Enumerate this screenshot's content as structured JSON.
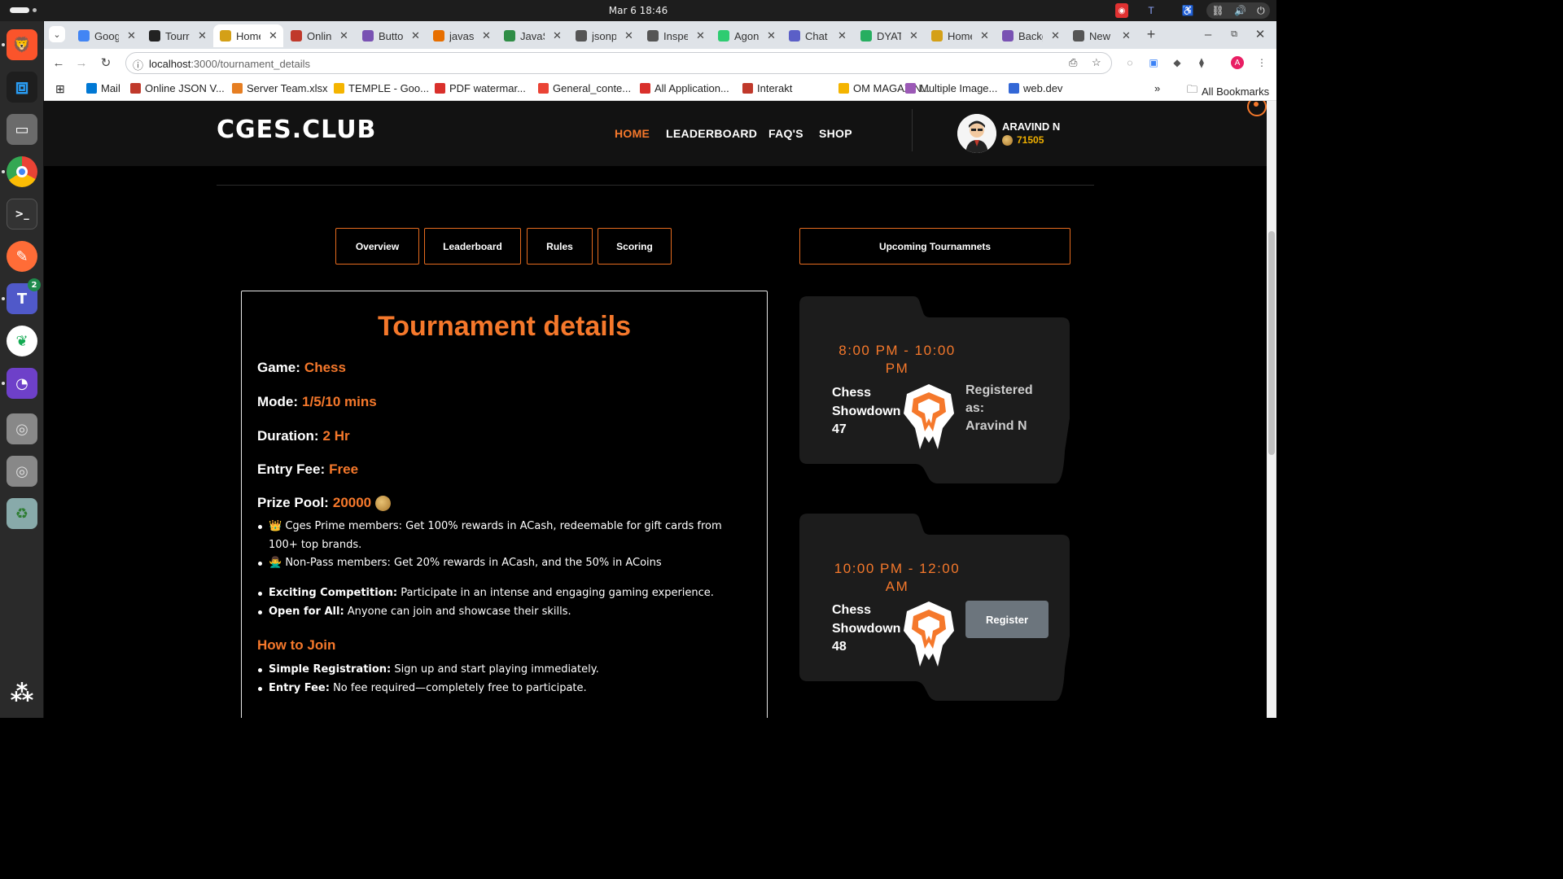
{
  "system": {
    "clock": "Mar 6  18:46"
  },
  "dock": {
    "items": [
      "brave-browser-icon",
      "vscode-icon",
      "files-icon",
      "chrome-icon",
      "terminal-icon",
      "postman-icon",
      "teams-icon",
      "mongodb-compass-icon",
      "github-desktop-icon",
      "disk-icon",
      "disk-icon-2",
      "trash-icon",
      "show-apps-icon"
    ],
    "teams_badge": "2"
  },
  "browser": {
    "tabs": [
      {
        "label": "Goog",
        "icon": "google-icon",
        "color": "#4285f4"
      },
      {
        "label": "Tourr",
        "icon": "github-icon",
        "color": "#222222"
      },
      {
        "label": "Home",
        "icon": "trophy-icon",
        "color": "#d4a017"
      },
      {
        "label": "Onlin",
        "icon": "json-viewer-icon",
        "color": "#c0392b"
      },
      {
        "label": "Butto",
        "icon": "bootstrap-icon",
        "color": "#7952b3"
      },
      {
        "label": "javas",
        "icon": "java-icon",
        "color": "#e76f00"
      },
      {
        "label": "JavaS",
        "icon": "geeks-icon",
        "color": "#2f8d46"
      },
      {
        "label": "jsonp",
        "icon": "jsonpath-icon",
        "color": "#555555"
      },
      {
        "label": "Inspe",
        "icon": "globe-icon",
        "color": "#555555"
      },
      {
        "label": "Agon",
        "icon": "agon-icon",
        "color": "#2ecc71"
      },
      {
        "label": "Chat",
        "icon": "teams-icon",
        "color": "#5b5fc7"
      },
      {
        "label": "DYAT",
        "icon": "dyat-icon",
        "color": "#27ae60"
      },
      {
        "label": "Home",
        "icon": "trophy-icon",
        "color": "#d4a017"
      },
      {
        "label": "Backg",
        "icon": "bootstrap-icon",
        "color": "#7952b3"
      },
      {
        "label": "New",
        "icon": "chrome-icon",
        "color": "#555555"
      }
    ],
    "url_host": "localhost",
    "url_path": ":3000/tournament_details",
    "profile_initial": "A",
    "bookmarks": [
      {
        "label": "Mail",
        "color": "#0078d4"
      },
      {
        "label": "Online JSON V...",
        "color": "#c0392b"
      },
      {
        "label": "Server Team.xlsx",
        "color": "#e67e22"
      },
      {
        "label": "TEMPLE - Goo...",
        "color": "#f4b400"
      },
      {
        "label": "PDF watermar...",
        "color": "#d9302b"
      },
      {
        "label": "General_conte...",
        "color": "#ea4335"
      },
      {
        "label": "All Application...",
        "color": "#d9302b"
      },
      {
        "label": "Interakt",
        "color": "#c0392b"
      },
      {
        "label": "OM MAGAZIN...",
        "color": "#f4b400"
      },
      {
        "label": "Multiple Image...",
        "color": "#9b59b6"
      },
      {
        "label": "web.dev",
        "color": "#3367d6"
      }
    ],
    "more_bookmarks": "»",
    "all_bookmarks": "All Bookmarks"
  },
  "site": {
    "logo": "CGES.CLUB",
    "nav": [
      "HOME",
      "LEADERBOARD",
      "FAQ'S",
      "SHOP"
    ],
    "active_nav": "HOME",
    "user": {
      "name": "ARAVIND N",
      "coins": "71505"
    },
    "tabs": [
      "Overview",
      "Leaderboard",
      "Rules",
      "Scoring"
    ],
    "upcoming_label": "Upcoming Tournamnets"
  },
  "details": {
    "title": "Tournament details",
    "game_label": "Game:",
    "game": "Chess",
    "mode_label": "Mode:",
    "mode": "1/5/10 mins",
    "duration_label": "Duration:",
    "duration": "2 Hr",
    "entry_label": "Entry Fee:",
    "entry": "Free",
    "prize_label": "Prize Pool:",
    "prize": "20000",
    "rewards": [
      "👑 Cges Prime members: Get 100% rewards in ACash, redeemable for gift cards from 100+ top brands.",
      "🙅‍♂️ Non-Pass members: Get 20% rewards in ACash, and the 50% in ACoins"
    ],
    "features": [
      {
        "bold": "Exciting Competition:",
        "text": " Participate in an intense and engaging gaming experience."
      },
      {
        "bold": "Open for All:",
        "text": " Anyone can join and showcase their skills."
      }
    ],
    "how_to_join": "How to Join",
    "join_steps": [
      {
        "bold": "Simple Registration:",
        "text": " Sign up and start playing immediately."
      },
      {
        "bold": "Entry Fee:",
        "text": " No fee required—completely free to participate."
      }
    ]
  },
  "upcoming": [
    {
      "time_line1": "8:00 PM - 10:00",
      "time_line2": "PM",
      "name_lines": [
        "Chess",
        "Showdown",
        "47"
      ],
      "status_lines": [
        "Registered",
        "as:",
        "Aravind N"
      ]
    },
    {
      "time_line1": "10:00 PM - 12:00",
      "time_line2": "AM",
      "name_lines": [
        "Chess",
        "Showdown",
        "48"
      ],
      "button": "Register"
    }
  ],
  "colors": {
    "accent": "#f5782b",
    "nav_bg": "#121212",
    "card_bg": "#1c1c1c",
    "button_gray": "#6c757d"
  }
}
